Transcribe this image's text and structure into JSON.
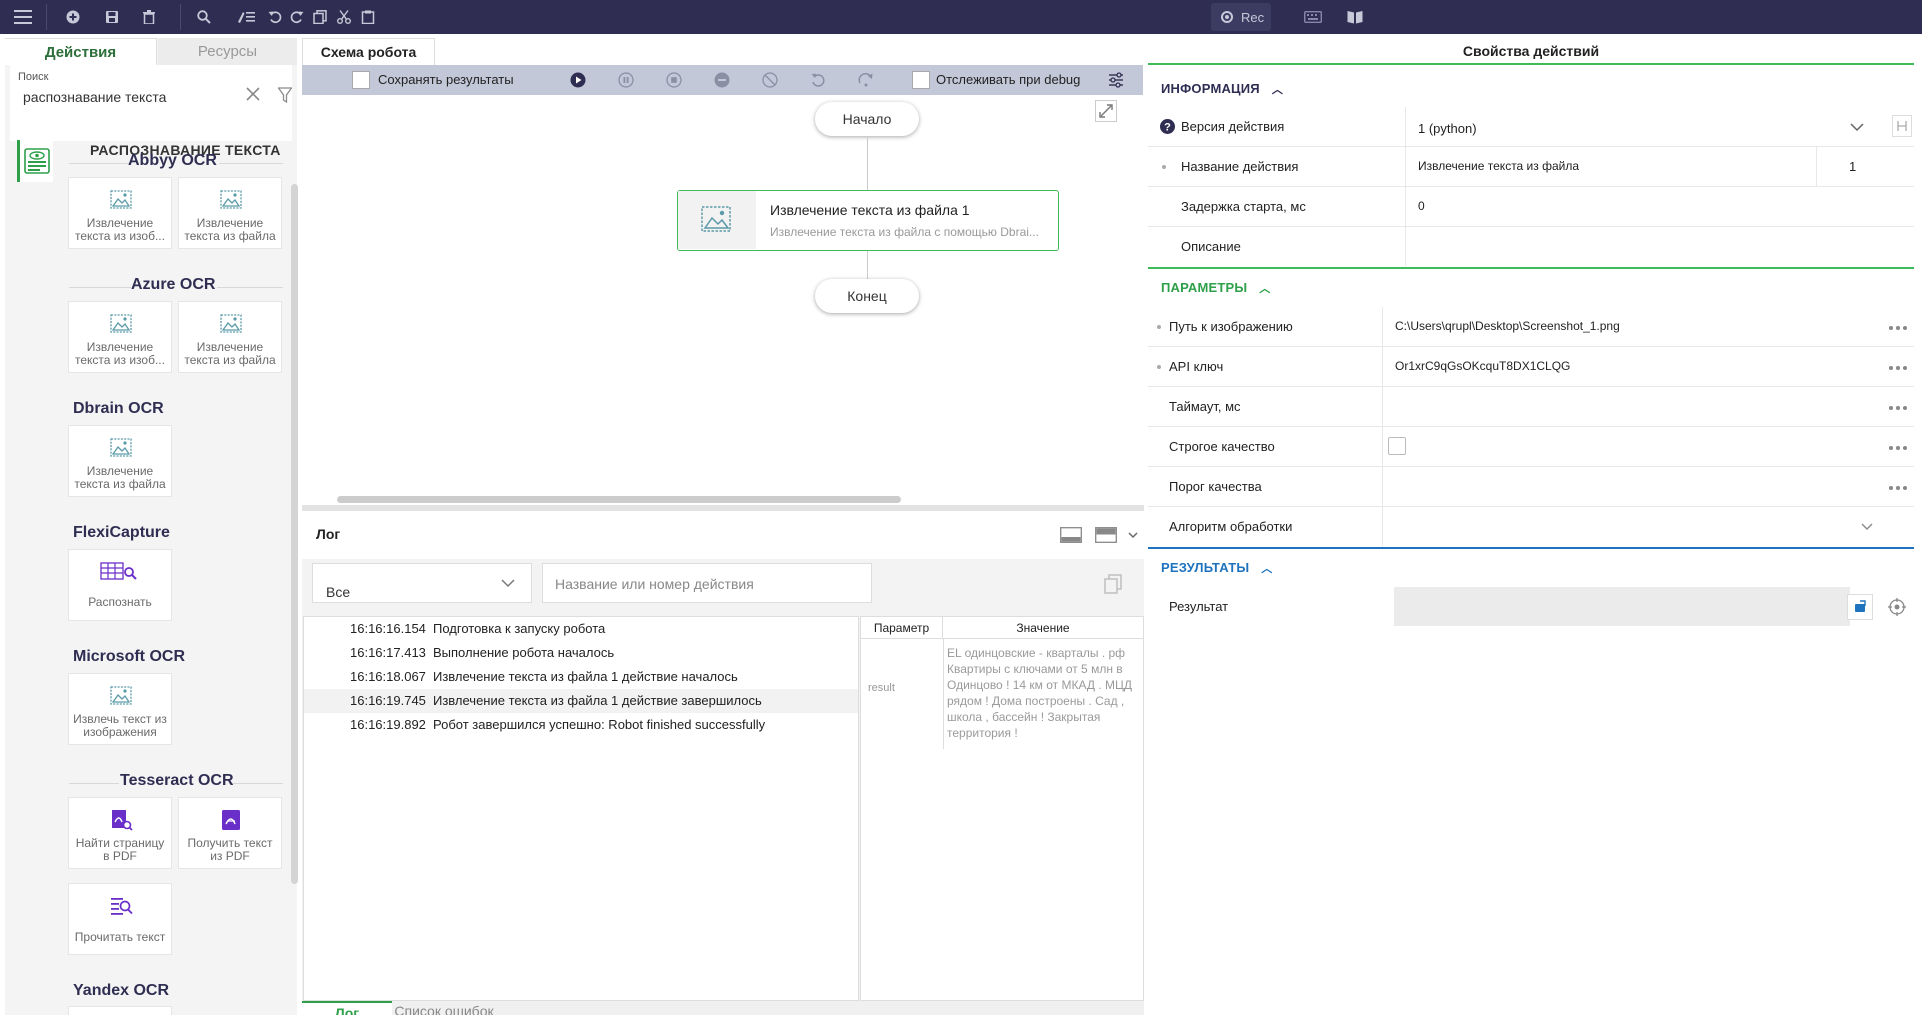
{
  "toolbar": {
    "icons": [
      "menu-icon",
      "add-icon",
      "save-icon",
      "delete-icon",
      "search-icon",
      "edit-list-icon",
      "undo-icon",
      "redo-icon",
      "copy-icon",
      "cut-icon",
      "paste-icon"
    ],
    "rec_label": "Rec"
  },
  "left": {
    "tab_actions": "Действия",
    "tab_resources": "Ресурсы",
    "search_label": "Поиск",
    "search_value": "распознавание текста",
    "root_title": "РАСПОЗНАВАНИЕ ТЕКСТА",
    "groups": [
      {
        "title": "Abbyy OCR",
        "items": [
          "Извлечение текста из изоб...",
          "Извлечение текста из файла"
        ]
      },
      {
        "title": "Azure OCR",
        "items": [
          "Извлечение текста из изоб...",
          "Извлечение текста из файла"
        ]
      },
      {
        "title": "Dbrain OCR",
        "items": [
          "Извлечение текста из файла"
        ]
      },
      {
        "title": "FlexiCapture",
        "items": [
          "Распознать"
        ]
      },
      {
        "title": "Microsoft OCR",
        "items": [
          "Извлечь текст из изображения"
        ]
      },
      {
        "title": "Tesseract OCR",
        "items": [
          "Найти страницу в PDF",
          "Получить текст из PDF",
          "Прочитать текст"
        ]
      },
      {
        "title": "Yandex OCR",
        "items": []
      }
    ]
  },
  "center": {
    "tab": "Схема робота",
    "save_results": "Сохранять результаты",
    "debug_track": "Отслеживать при debug",
    "start_node": "Начало",
    "end_node": "Конец",
    "action_node": {
      "title": "Извлечение текста из файла  1",
      "subtitle": "Извлечение текста из файла с помощью Dbrai..."
    },
    "log": {
      "title": "Лог",
      "filter_value": "Все",
      "search_placeholder": "Название или номер действия",
      "rows": [
        {
          "time": "16:16:16.154",
          "message": "Подготовка к запуску робота"
        },
        {
          "time": "16:16:17.413",
          "message": "Выполнение робота началось"
        },
        {
          "time": "16:16:18.067",
          "message": "Извлечение текста из файла 1 действие началось"
        },
        {
          "time": "16:16:19.745",
          "message": "Извлечение текста из файла 1 действие завершилось"
        },
        {
          "time": "16:16:19.892",
          "message": "Робот завершился успешно: Robot finished successfully"
        }
      ],
      "param_header": "Параметр",
      "value_header": "Значение",
      "param_name": "result",
      "param_value": "EL одинцовские - кварталы . рф Квартиры с ключами от 5 млн в Одинцово ! 14 км от МКАД . МЦД рядом ! Дома построены . Сад , школа , бассейн ! Закрытая территория !"
    },
    "bottom_tabs": [
      "Лог",
      "Список ошибок"
    ]
  },
  "right": {
    "title": "Свойства действий",
    "info_header": "ИНФОРМАЦИЯ",
    "version_label": "Версия действия",
    "version_value": "1 (python)",
    "name_label": "Название действия",
    "name_value": "Извлечение текста из файла",
    "name_number": "1",
    "delay_label": "Задержка старта, мс",
    "delay_value": "0",
    "desc_label": "Описание",
    "params_header": "ПАРАМЕТРЫ",
    "path_label": "Путь к изображению",
    "path_value": "C:\\Users\\qrupl\\Desktop\\Screenshot_1.png",
    "api_label": "API ключ",
    "api_value": "Or1xrC9qGsOKcquT8DX1CLQG",
    "timeout_label": "Таймаут, мс",
    "strict_label": "Строгое качество",
    "threshold_label": "Порог качества",
    "algo_label": "Алгоритм обработки",
    "results_header": "РЕЗУЛЬТАТЫ",
    "result_label": "Результат"
  },
  "colors": {
    "toolbar": "#2f2e52",
    "accent_green": "#2ea04a",
    "accent_blue": "#1e73be",
    "icon_violet": "#6b2fc9"
  }
}
